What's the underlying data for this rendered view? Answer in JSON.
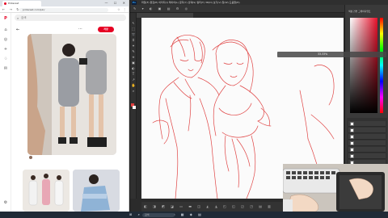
{
  "browser": {
    "tab_title": "Pinterest",
    "url": "pinterest.com/pin/",
    "window_buttons": "— ☐ ✕",
    "nav_icons": "← → ↻",
    "ext_icons": "☆ ⋮",
    "search_placeholder": "검색",
    "more_label": "···",
    "save_label": "저장",
    "profile_name": "",
    "related_title": "",
    "sidebar_icons": [
      "pinterest-logo-icon",
      "home-icon",
      "explore-icon",
      "create-icon",
      "notifications-icon",
      "messages-icon",
      "settings-icon"
    ]
  },
  "ps": {
    "logo": "Ps",
    "menu": "파일(F)  편집(E)  이미지(I)  레이어(L)  문자(Y)  선택(S)  필터(T)  3D(D)  보기(V)  창(W)  도움말(H)",
    "options_icons": "✎ ▾  ◐ ▣ ▤  ⚙  ◎",
    "doc_tab": "",
    "status": "",
    "zoom_hud": "33.33%",
    "panel_tabs": "색상  견본  그레이디언트",
    "tools": [
      "↖",
      "⬚",
      "✂",
      "⌖",
      "✎",
      "⟡",
      "▣",
      "◐",
      "T",
      "↗",
      "✋",
      "🔍"
    ],
    "layers": [
      "",
      "",
      "",
      "",
      "",
      "",
      ""
    ]
  },
  "taskbar": {
    "weather": "",
    "search": "검색",
    "tray_icons": "⊞  ⌕  ◫  ▣  ◉  ◍  ▦  ◈  ▤",
    "time": "",
    "date": ""
  },
  "colors": {
    "accent": "#e60023",
    "sketch": "#e04040"
  }
}
